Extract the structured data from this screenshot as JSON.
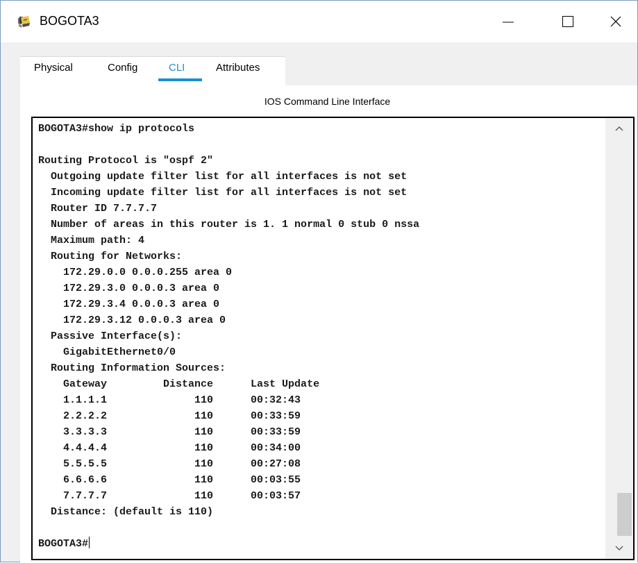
{
  "window": {
    "title": "BOGOTA3",
    "app_icon": "packet-tracer-router-icon",
    "controls": [
      "minimize-icon",
      "maximize-icon",
      "close-icon"
    ]
  },
  "tabs": [
    {
      "label": "Physical",
      "active": false
    },
    {
      "label": "Config",
      "active": false
    },
    {
      "label": "CLI",
      "active": true
    },
    {
      "label": "Attributes",
      "active": false
    }
  ],
  "cli": {
    "heading": "IOS Command Line Interface",
    "output": "BOGOTA3#show ip protocols\n\nRouting Protocol is \"ospf 2\"\n  Outgoing update filter list for all interfaces is not set\n  Incoming update filter list for all interfaces is not set\n  Router ID 7.7.7.7\n  Number of areas in this router is 1. 1 normal 0 stub 0 nssa\n  Maximum path: 4\n  Routing for Networks:\n    172.29.0.0 0.0.0.255 area 0\n    172.29.3.0 0.0.0.3 area 0\n    172.29.3.4 0.0.0.3 area 0\n    172.29.3.12 0.0.0.3 area 0\n  Passive Interface(s):\n    GigabitEthernet0/0\n  Routing Information Sources:\n    Gateway         Distance      Last Update\n    1.1.1.1              110      00:32:43\n    2.2.2.2              110      00:33:59\n    3.3.3.3              110      00:33:59\n    4.4.4.4              110      00:34:00\n    5.5.5.5              110      00:27:08\n    6.6.6.6              110      00:03:55\n    7.7.7.7              110      00:03:57\n  Distance: (default is 110)\n\nBOGOTA3#"
  },
  "colors": {
    "active_tab_text": "#1e8fd6",
    "active_tab_underline": "#1a8fd8",
    "window_border": "#7a9cc6"
  }
}
